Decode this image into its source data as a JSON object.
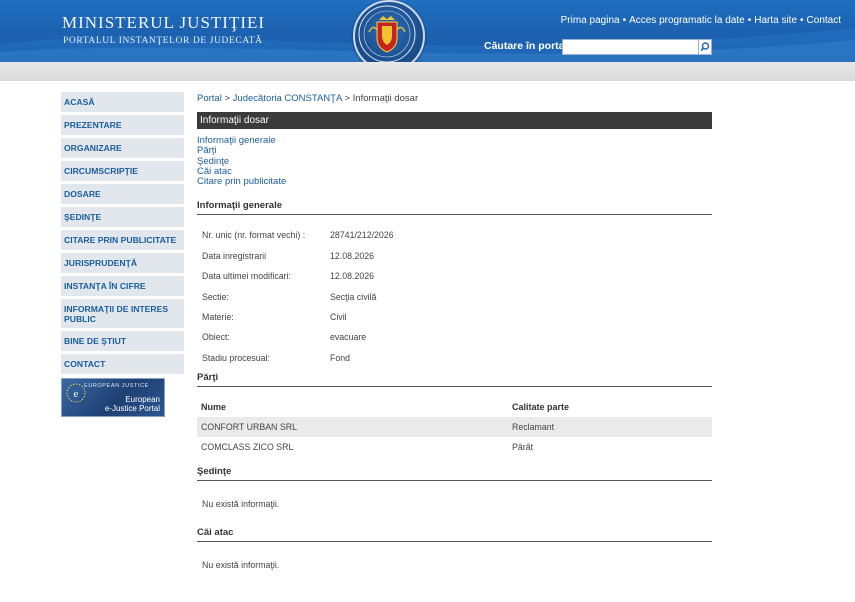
{
  "header": {
    "title": "MINISTERUL JUSTIŢIEI",
    "subtitle": "PORTALUL INSTANŢELOR DE JUDECATĂ",
    "nav": [
      "Prima pagina",
      "Acces programatic la date",
      "Harta site",
      "Contact"
    ],
    "search_label": "Căutare în portal",
    "search_placeholder": ""
  },
  "sidebar": {
    "items": [
      "ACASĂ",
      "PREZENTARE",
      "ORGANIZARE",
      "CIRCUMSCRIPŢIE",
      "DOSARE",
      "ŞEDINŢE",
      "CITARE PRIN PUBLICITATE",
      "JURISPRUDENŢĂ",
      "INSTANŢA ÎN CIFRE",
      "INFORMAŢII DE INTERES PUBLIC",
      "BINE DE ŞTIUT",
      "CONTACT"
    ],
    "ejustice": {
      "small": "EUROPEAN JUSTICE",
      "line1": "European",
      "line2": "e-Justice Portal"
    }
  },
  "breadcrumb": {
    "portal": "Portal",
    "sep": ">",
    "court": "Judecătoria CONSTANŢA",
    "current": "Informaţii dosar"
  },
  "panel_title": "Informaţii dosar",
  "quick_links": [
    "Informaţii generale",
    "Părţi",
    "Şedinţe",
    "Căi atac",
    "Citare prin publicitate"
  ],
  "general": {
    "heading": "Informaţii generale",
    "rows": [
      {
        "label": "Nr. unic (nr. format vechi) :",
        "value": "28741/212/2026"
      },
      {
        "label": "Data inregistrarii",
        "value": "12.08.2026"
      },
      {
        "label": "Data ultimei modificari:",
        "value": "12.08.2026"
      },
      {
        "label": "Sectie:",
        "value": "Secţia civilă"
      },
      {
        "label": "Materie:",
        "value": "Civil"
      },
      {
        "label": "Obiect:",
        "value": "evacuare"
      },
      {
        "label": "Stadiu procesual:",
        "value": "Fond"
      }
    ]
  },
  "parties": {
    "heading": "Părţi",
    "col_name": "Nume",
    "col_role": "Calitate parte",
    "rows": [
      {
        "name": "CONFORT URBAN SRL",
        "role": "Reclamant"
      },
      {
        "name": "COMCLASS ZICO SRL",
        "role": "Pârât"
      }
    ]
  },
  "hearings": {
    "heading": "Şedinţe",
    "empty": "Nu există informaţii."
  },
  "appeals": {
    "heading": "Căi atac",
    "empty": "Nu există informaţii."
  },
  "colors": {
    "header_blue": "#1d63b2",
    "link_blue": "#1a5d9c",
    "sidebar_bg": "#e2e7ed",
    "panel_dark": "#3b3b3b"
  }
}
